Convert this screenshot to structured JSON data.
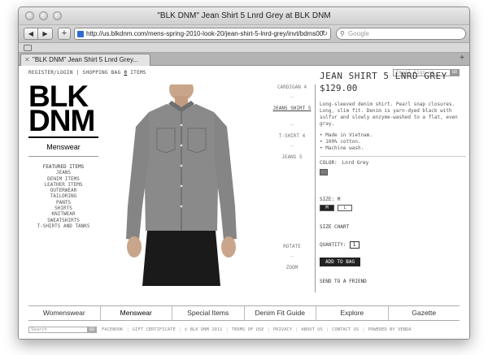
{
  "browser": {
    "window_title": "\"BLK DNM\" Jean Shirt 5 Lnrd Grey at BLK DNM",
    "url": "http://us.blkdnm.com/mens-spring-2010-look-20/jean-shirt-5-lnrd-grey/invt/bdms00",
    "search_placeholder": "Google",
    "tab_title": "\"BLK DNM\" Jean Shirt 5 Lnrd Grey..."
  },
  "header": {
    "register_login": "REGISTER/LOGIN",
    "separator": "|",
    "shopping_bag": "SHOPPING BAG",
    "bag_count": "0",
    "items": "ITEMS",
    "email_placeholder": "Email Sign-up",
    "email_go": "GO"
  },
  "brand": {
    "logo_line1": "BLK",
    "logo_line2": "DNM",
    "section": "Menswear"
  },
  "sidebar": {
    "featured": "FEATURED ITEMS",
    "items": [
      "JEANS",
      "DENIM ITEMS",
      "LEATHER ITEMS",
      "OUTERWEAR",
      "TAILORING",
      "PANTS",
      "SHIRTS",
      "KNITWEAR",
      "SWEATSHIRTS",
      "T-SHIRTS AND TANKS"
    ]
  },
  "thumbs": {
    "items": [
      {
        "label": "CARDIGAN 4"
      },
      {
        "label": "JEANS SHIRT 5"
      },
      {
        "label": "T-SHIRT 4"
      },
      {
        "label": "JEANS 5"
      }
    ],
    "dash": "–",
    "rotate": "ROTATE",
    "zoom": "ZOOM"
  },
  "product": {
    "title": "JEAN SHIRT 5 LNRD GREY",
    "price": "$129.00",
    "description": "Long-sleeved denim shirt. Pearl snap closures. Long, slim fit. Denim is yarn-dyed black with sulfur and slowly enzyme-washed to a flat, even gray.",
    "bullets": [
      "• Made in Vietnam.",
      "• 100% cotton.",
      "• Machine wash."
    ],
    "color_label": "COLOR:",
    "color_value": "Lnrd Grey",
    "swatch_color": "#7a7a7a",
    "size_label": "SIZE:",
    "size_value": "M",
    "sizes": [
      "M",
      "L"
    ],
    "size_chart": "SIZE CHART",
    "quantity_label": "QUANTITY:",
    "quantity_value": "1",
    "add_to_bag": "ADD TO BAG",
    "send_friend": "SEND TO A FRIEND"
  },
  "bottom_nav": [
    "Womenswear",
    "Menswear",
    "Special Items",
    "Denim Fit Guide",
    "Explore",
    "Gazette"
  ],
  "footer": {
    "search_placeholder": "Search",
    "search_go": "GO",
    "links": [
      "FACEBOOK",
      "GIFT CERTIFICATE",
      "© BLK DNM 2011",
      "TERMS OF USE",
      "PRIVACY",
      "ABOUT US",
      "CONTACT US",
      "POWERED BY VENDA"
    ]
  }
}
